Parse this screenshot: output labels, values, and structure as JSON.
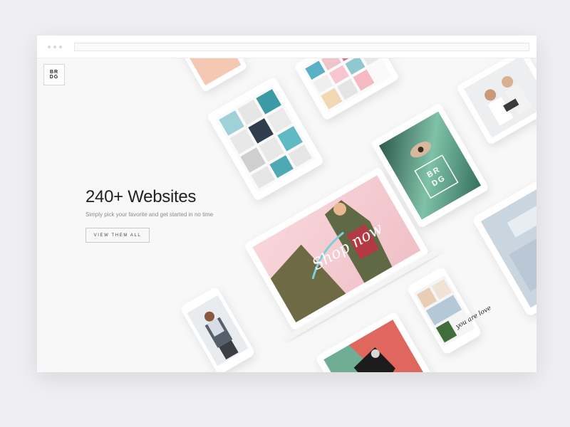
{
  "browser": {
    "url_placeholder": ""
  },
  "logo": {
    "text": "BR\nDG"
  },
  "hero": {
    "title": "240+ Websites",
    "subtitle": "Simply pick your favorite and get started in no time",
    "cta_label": "VIEW THEM ALL"
  },
  "showcase": {
    "laptop_script": "Shop now",
    "tablet_logo": "BR\nDG",
    "phone_script": "you are love"
  },
  "colors": {
    "page_bg": "#efeff3",
    "window_bg": "#f8f8f8",
    "pink": "#f4c9cf",
    "teal": "#4fb8c4",
    "olive": "#6e6a44",
    "coral": "#e0675e",
    "green": "#6fae95"
  },
  "icons": [
    "window-dot-icon"
  ]
}
